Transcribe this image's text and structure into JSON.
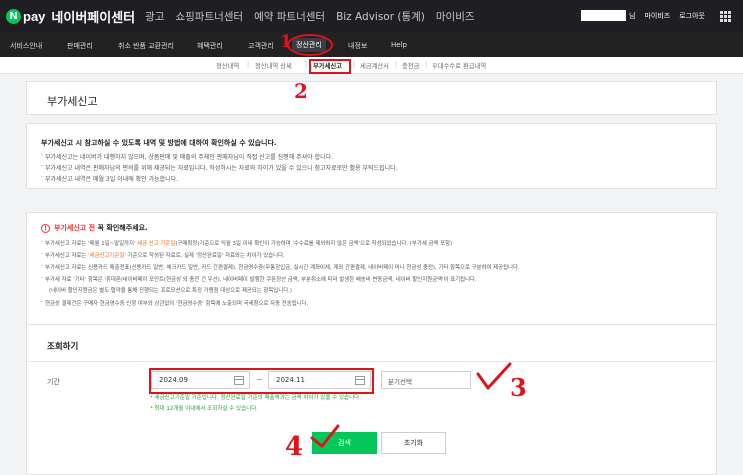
{
  "topbar": {
    "logo_n": "N",
    "logo_pay": "pay",
    "title": "네이버페이센터",
    "nav": [
      "광고",
      "쇼핑파트너센터",
      "예약 파트너센터",
      "Biz Advisor (통계)",
      "마이비즈"
    ],
    "user_suffix": "님",
    "mybiz": "마이비즈",
    "logout": "로그아웃"
  },
  "mainnav": {
    "items": [
      "서비스안내",
      "판매관리",
      "취소 반품 교환관리",
      "혜택관리",
      "고객관리",
      "정산관리",
      "내정보",
      "Help"
    ],
    "active_index": 5
  },
  "subnav": {
    "items": [
      "정산내역",
      "정산내역 상세",
      "부가세신고",
      "세금계산서",
      "충전금",
      "우대수수료 환급내역"
    ],
    "selected_index": 2,
    "separator": "|"
  },
  "page": {
    "title": "부가세신고"
  },
  "info": {
    "title": "부가세신고 시 참고하실 수 있도록 내역 및 방법에 대하여 확인하실 수 있습니다.",
    "lines": [
      "부가세신고는 네이버가 대행하지 않으며, 상품판매 및 매출의 주체인 판매자님이 직접 신고를 진행해 주셔야 합니다.",
      "부가세신고 내역은 판매자님의 편의를 위해 제공되는 자료입니다. 작성하시는 자료와 차이가 있을 수 있으니 참고자료로만 활용 부탁드립니다.",
      "부가세신고 내역은 매월 3일 이내에 확인 가능합니다."
    ]
  },
  "warning": {
    "head_orange": "부가세신고 전",
    "head_rest": "꼭 확인해주세요.",
    "icon": "!",
    "lines": [
      {
        "pre": "부가세신고 자료는 '매월 1일~말일까지' ",
        "orange": "세금 신고 기준일",
        "post": "(구매확정)기준으로 익월 3일 이내 확인이 가능하며 '수수료를 제외하지 않은 금액'으로 작성되었습니다. (부가세 금액 포함)"
      },
      {
        "pre": "부가세신고 자료는 ",
        "orange": "'세금신고기준일'",
        "post": " 기준으로 작성된 자료로, 실제 '정산완료일' 자료와는 차이가 있습니다."
      },
      {
        "pre": "부가세신고 자료는 신용카드 매출전표(신용카드 일반, 체크카드 일반, 카드 간편결제), 현금영수증(무통장입금, 실시간 계좌이체, 계좌 간편결제, 네이버페이 머니 현금성 충전), 기타 항목으로 구분하여 제공됩니다.",
        "orange": "",
        "post": ""
      },
      {
        "pre": "부가세 자료 '기타' 항목은 '휴대폰/네이버페이 포인트(현금성 외 충전 건 우선), 네이버페이 발행한 쿠폰정산 금액, 부분취소에 따라 발생한 배송비 변동금액, 네이버 할인지원금액'이 표기됩니다.",
        "orange": "",
        "post": ""
      },
      {
        "pre": "(네이버 할인지원금은 별도 협약을 통해 진행되는 프로모션으로 특정 가맹점 대상으로 제공되는 항목입니다.)",
        "orange": "",
        "post": ""
      },
      {
        "pre": "현금성 결제건은 구매자 현금영수증 신청 여부와 상관없이 '현금영수증' 항목에 노출되며 국세청으로 자동 전송됩니다.",
        "orange": "",
        "post": ""
      }
    ]
  },
  "search": {
    "title": "조회하기",
    "period_label": "기간",
    "start": "2024.09",
    "end": "2024.11",
    "range_sep": "~",
    "quarter_placeholder": "분기선택",
    "notes": [
      "* 세금신고기준일 기준입니다. 정산완료일 기준의 매출액과는 금액 차이가 있을 수 있습니다.",
      "* 최대 12개월 이내에서 조회하실 수 있습니다."
    ],
    "search_button": "검색",
    "reset_button": "초기화"
  },
  "annotations": {
    "n1": "1",
    "n2": "2",
    "n3": "3",
    "n4": "4",
    "color": "#e0121b"
  }
}
